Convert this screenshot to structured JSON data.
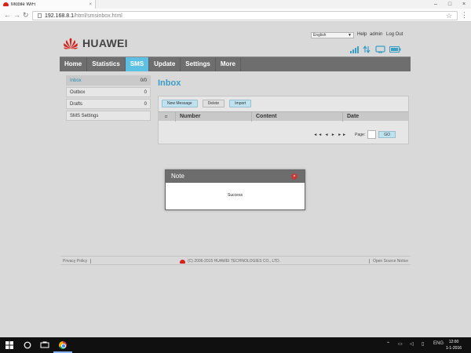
{
  "browser": {
    "tab_title": "Mobile WiFi",
    "tab_close": "×",
    "url_host": "192.168.8.1",
    "url_path": "/html/smsinbox.html",
    "back": "←",
    "forward": "→",
    "reload": "↻",
    "star": "☆",
    "menu": "⋮",
    "win_min": "–",
    "win_max": "□",
    "win_close": "×"
  },
  "header": {
    "brand": "HUAWEI",
    "language": "English",
    "help": "Help",
    "user": "admin",
    "logout": "Log Out",
    "status_icons": [
      "signal-icon",
      "data-transfer-icon",
      "wifi-device-icon",
      "battery-icon"
    ]
  },
  "nav": [
    {
      "label": "Home"
    },
    {
      "label": "Statistics"
    },
    {
      "label": "SMS"
    },
    {
      "label": "Update"
    },
    {
      "label": "Settings"
    },
    {
      "label": "More"
    }
  ],
  "active_nav": "SMS",
  "sidebar": {
    "items": [
      {
        "label": "Inbox",
        "count": "0/0"
      },
      {
        "label": "Outbox",
        "count": "0"
      },
      {
        "label": "Drafts",
        "count": "0"
      },
      {
        "label": "SMS Settings",
        "count": ""
      }
    ]
  },
  "main": {
    "title": "Inbox",
    "buttons": {
      "new": "New Message",
      "delete": "Delete",
      "import": "Import"
    },
    "columns": [
      "Number",
      "Content",
      "Date"
    ],
    "pager": {
      "arrows": "◄◄ ◄ ► ►►",
      "page_label": "Page:",
      "go": "GO"
    }
  },
  "dialog": {
    "title": "Note",
    "message": "Success",
    "close": "×"
  },
  "footer": {
    "privacy": "Privacy Policy",
    "copyright": "(C) 2006-2015 HUAWEI TECHNOLOGIES CO., LTD.",
    "open_source": "Open Source Notice"
  },
  "taskbar": {
    "language": "ENG",
    "time": "12:00",
    "date": "1-1-2016"
  },
  "colors": {
    "accent": "#5bc0e3",
    "nav_bg": "#6e6e6e",
    "title_blue": "#3a9ec7",
    "brand_red": "#d6221b"
  }
}
